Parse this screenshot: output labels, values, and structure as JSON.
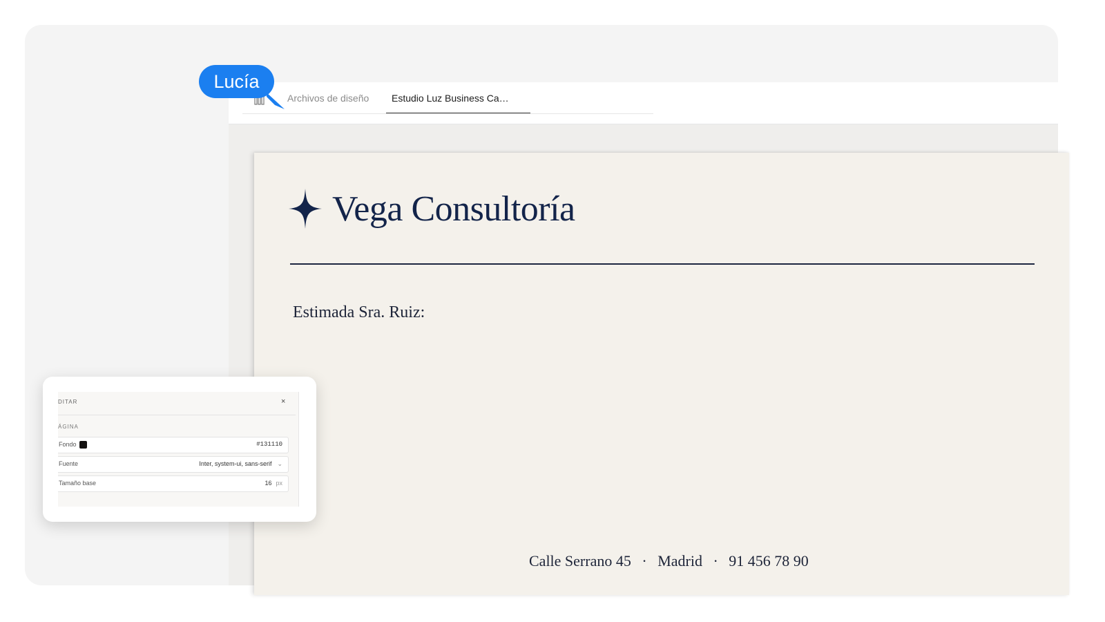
{
  "tabs": [
    {
      "label": "Archivos de diseño",
      "active": false
    },
    {
      "label": "Estudio Luz Business Ca…",
      "active": true
    }
  ],
  "cursor": {
    "user": "Lucía",
    "color": "#1b7ff0"
  },
  "document": {
    "brand_name": "Vega Consultoría",
    "salutation": "Estimada Sra. Ruiz:",
    "footer": {
      "address": "Calle Serrano 45",
      "city": "Madrid",
      "phone": "91 456 78 90",
      "separator": "·"
    },
    "ink_color": "#13244a",
    "paper_color": "#f4f1eb"
  },
  "panel": {
    "title": "DITAR",
    "close_label": "×",
    "section_label": "ÁGINA",
    "fields": {
      "background": {
        "label": "Fondo",
        "value": "#131110"
      },
      "font": {
        "label": "Fuente",
        "value": "Inter, system-ui, sans-serif"
      },
      "base_size": {
        "label": "Tamaño base",
        "value": "16",
        "unit": "px"
      }
    }
  }
}
